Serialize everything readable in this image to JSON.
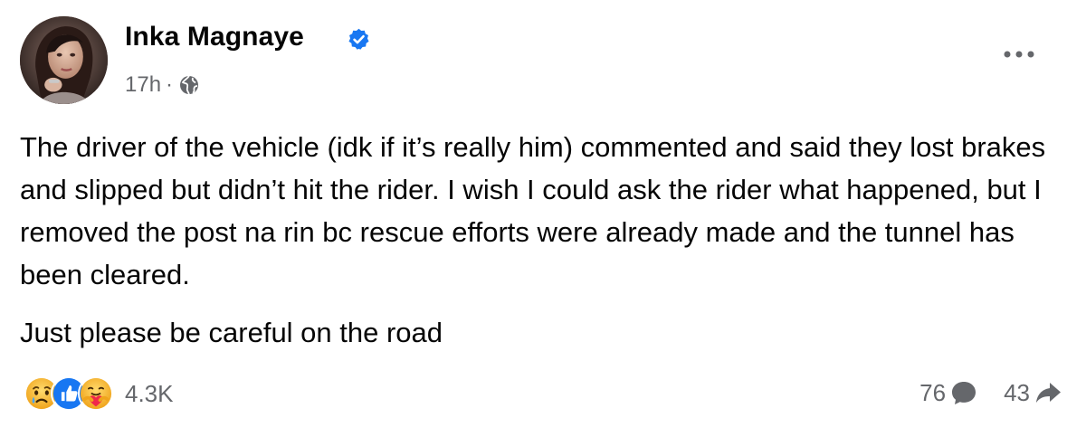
{
  "post": {
    "author": {
      "name": "Inka Magnaye",
      "verified": true,
      "verified_color": "#1877f2"
    },
    "timestamp": "17h",
    "separator": "·",
    "audience_icon": "globe-icon",
    "menu_icon": "more-options-icon",
    "paragraphs": [
      "The driver of the vehicle (idk if it’s really him) commented and said they lost brakes and slipped but didn’t hit the rider. I wish I could ask the rider what happened, but I removed the post na rin bc rescue efforts were already made and the tunnel has been cleared.",
      "Just please be careful on the road"
    ],
    "reactions": {
      "icons": [
        "sad-reaction-icon",
        "like-reaction-icon",
        "care-reaction-icon"
      ],
      "count": "4.3K"
    },
    "comments": {
      "count": "76",
      "icon": "comment-icon"
    },
    "shares": {
      "count": "43",
      "icon": "share-icon"
    },
    "colors": {
      "text": "#050505",
      "secondary": "#65676b",
      "like_blue": "#1877f2",
      "emoji_yellow": "#f7b125"
    }
  }
}
